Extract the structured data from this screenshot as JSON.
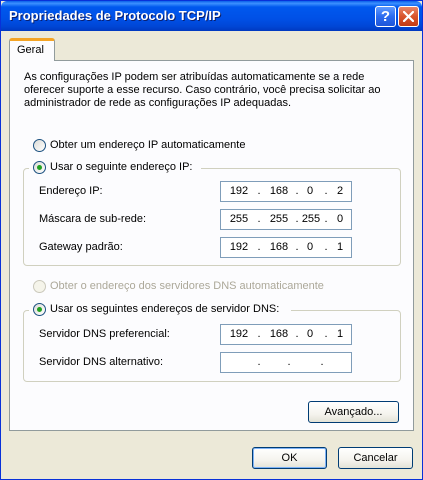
{
  "window": {
    "title": "Propriedades de Protocolo TCP/IP",
    "help_glyph": "?"
  },
  "tabs": [
    {
      "label": "Geral"
    }
  ],
  "intro": "As configurações IP podem ser atribuídas automaticamente se a rede oferecer suporte a esse recurso. Caso contrário, você precisa solicitar ao administrador de rede as configurações IP adequadas.",
  "ip_section": {
    "auto_label": "Obter um endereço IP automaticamente",
    "manual_label": "Usar o seguinte endereço IP:",
    "selected": "manual",
    "fields": [
      {
        "label": "Endereço IP:",
        "octets": [
          "192",
          "168",
          "0",
          "2"
        ]
      },
      {
        "label": "Máscara de sub-rede:",
        "octets": [
          "255",
          "255",
          "255",
          "0"
        ]
      },
      {
        "label": "Gateway padrão:",
        "octets": [
          "192",
          "168",
          "0",
          "1"
        ]
      }
    ]
  },
  "dns_section": {
    "auto_label": "Obter o endereço dos servidores DNS automaticamente",
    "manual_label": "Usar os seguintes endereços de servidor DNS:",
    "selected": "manual",
    "fields": [
      {
        "label": "Servidor DNS preferencial:",
        "octets": [
          "192",
          "168",
          "0",
          "1"
        ]
      },
      {
        "label": "Servidor DNS alternativo:",
        "octets": [
          "",
          "",
          "",
          ""
        ]
      }
    ]
  },
  "separator": ".",
  "buttons": {
    "advanced": "Avançado...",
    "ok": "OK",
    "cancel": "Cancelar"
  },
  "colors": {
    "titlebar": "#0054E3",
    "window_bg": "#ECE9D8",
    "radio_dot": "#21A121",
    "tab_highlight": "#F4A425"
  }
}
